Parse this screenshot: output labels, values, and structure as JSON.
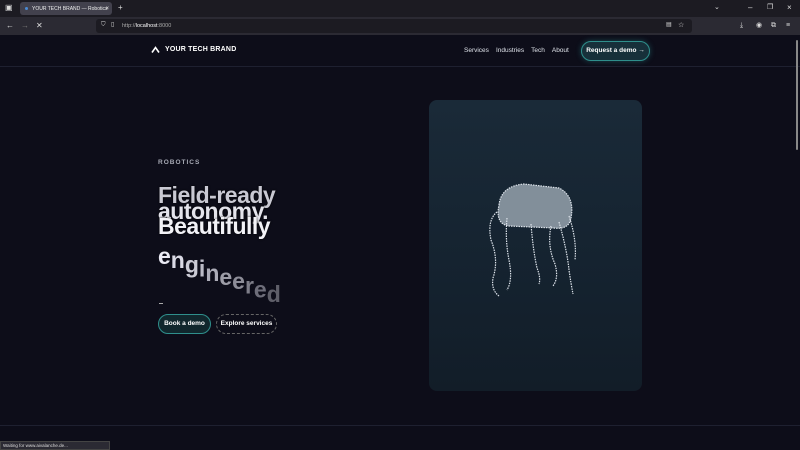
{
  "browser": {
    "tab_title": "YOUR TECH BRAND — Robotics",
    "url_prefix": "http://",
    "url_host": "localhost",
    "url_port": ":8000",
    "status": "Waiting for www.aivalanche.de..."
  },
  "header": {
    "brand": "YOUR TECH BRAND",
    "links": [
      "Services",
      "Industries",
      "Tech",
      "About"
    ],
    "cta": "Request a demo →"
  },
  "hero": {
    "eyebrow": "ROBOTICS",
    "line1": "Field-ready",
    "line2": "autonomy.",
    "line3": "Beautifully",
    "line4": "engineered",
    "dash": "-",
    "primary": "Book a demo",
    "secondary": "Explore services"
  },
  "colors": {
    "accent": "#2f8f8c",
    "bg": "#0d0d19",
    "card": "#172431"
  }
}
